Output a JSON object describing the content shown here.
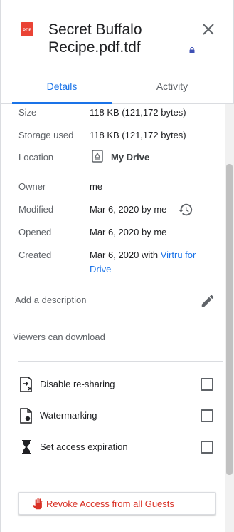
{
  "header": {
    "file_icon_text": "PDF",
    "title_line1": "Secret Buffalo",
    "title_line2": "Recipe.pdf.tdf"
  },
  "tabs": [
    {
      "label": "Details",
      "active": true
    },
    {
      "label": "Activity",
      "active": false
    }
  ],
  "details": {
    "size": {
      "label": "Size",
      "value": "118 KB (121,172 bytes)"
    },
    "storage": {
      "label": "Storage used",
      "value": "118 KB (121,172 bytes)"
    },
    "location": {
      "label": "Location",
      "value": "My Drive"
    },
    "owner": {
      "label": "Owner",
      "value": "me"
    },
    "modified": {
      "label": "Modified",
      "value": "Mar 6, 2020 by me"
    },
    "opened": {
      "label": "Opened",
      "value": "Mar 6, 2020 by me"
    },
    "created": {
      "label": "Created",
      "value_prefix": "Mar 6, 2020 with ",
      "link_part1": "Virtru for",
      "link_part2": "Drive"
    }
  },
  "description": {
    "placeholder": "Add a description"
  },
  "viewers_label": "Viewers can download",
  "options": [
    {
      "label": "Disable re-sharing",
      "checked": false
    },
    {
      "label": "Watermarking",
      "checked": false
    },
    {
      "label": "Set access expiration",
      "checked": false
    }
  ],
  "revoke_button": {
    "label": "Revoke Access from all Guests"
  },
  "colors": {
    "accent": "#1a73e8",
    "danger": "#d93025",
    "pdf_red": "#ea4335"
  }
}
